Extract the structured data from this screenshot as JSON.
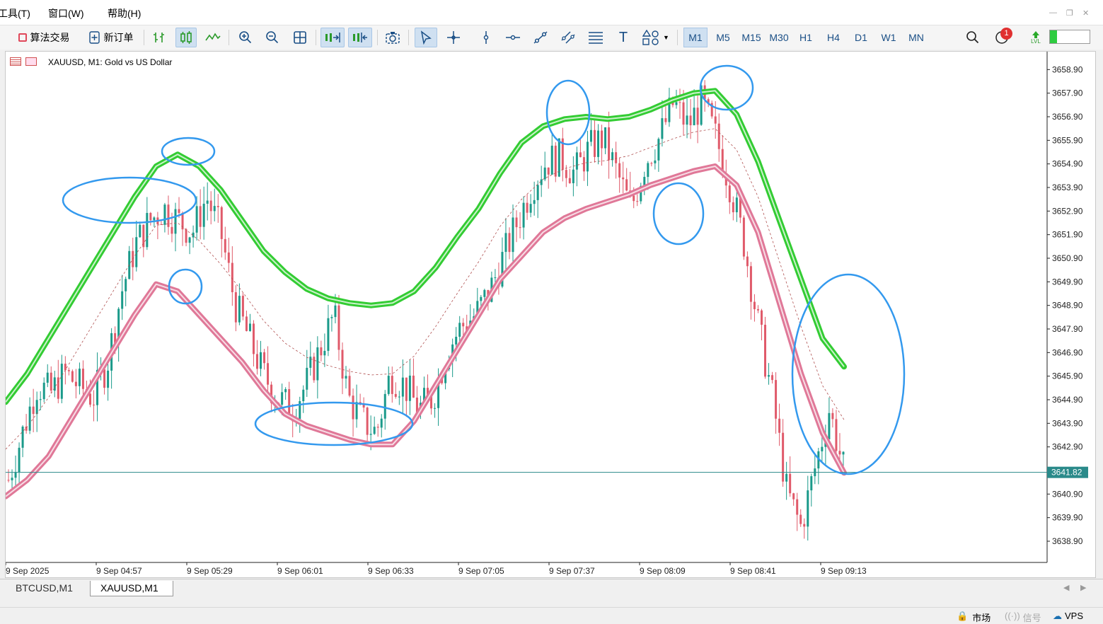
{
  "menu": {
    "tools": "工具(T)",
    "window": "窗口(W)",
    "help": "帮助(H)"
  },
  "toolbar": {
    "algo_trading": "算法交易",
    "new_order": "新订单",
    "timeframes": [
      "M1",
      "M5",
      "M15",
      "M30",
      "H1",
      "H4",
      "D1",
      "W1",
      "MN"
    ],
    "active_timeframe": "M1",
    "notification_count": "1",
    "lvl_label": "LVL"
  },
  "chart": {
    "title": "XAUUSD, M1:  Gold vs US Dollar",
    "current_price": "3641.82",
    "colors": {
      "upper_band": "#33cc33",
      "lower_band": "#e07898",
      "candle_up": "#1a9a8a",
      "candle_down": "#e05a6a",
      "circle": "#3399ee",
      "price_line": "#2a8a8a"
    }
  },
  "chart_data": {
    "type": "candlestick",
    "symbol": "XAUUSD",
    "timeframe": "M1",
    "y_axis": [
      "3658.90",
      "3657.90",
      "3656.90",
      "3655.90",
      "3654.90",
      "3653.90",
      "3652.90",
      "3651.90",
      "3650.90",
      "3649.90",
      "3648.90",
      "3647.90",
      "3646.90",
      "3645.90",
      "3644.90",
      "3643.90",
      "3642.90",
      "3641.90",
      "3640.90",
      "3639.90",
      "3638.90"
    ],
    "ylim": [
      3638.0,
      3659.3
    ],
    "x_axis": [
      "9 Sep 2025",
      "9 Sep 04:57",
      "9 Sep 05:29",
      "9 Sep 06:01",
      "9 Sep 06:33",
      "9 Sep 07:05",
      "9 Sep 07:37",
      "9 Sep 08:09",
      "9 Sep 08:41",
      "9 Sep 09:13"
    ],
    "close_path": [
      3641.5,
      3643.5,
      3645.5,
      3645.2,
      3646.0,
      3645.5,
      3645.0,
      3646.5,
      3649.5,
      3651.5,
      3652.5,
      3653.0,
      3652.5,
      3652.0,
      3653.5,
      3652.0,
      3649.0,
      3647.5,
      3646.0,
      3645.0,
      3644.5,
      3645.5,
      3647.0,
      3648.5,
      3645.0,
      3644.0,
      3643.5,
      3646.0,
      3645.5,
      3644.5,
      3645.0,
      3647.0,
      3648.0,
      3648.5,
      3649.5,
      3651.0,
      3652.5,
      3654.0,
      3655.0,
      3655.2,
      3654.5,
      3655.5,
      3656.0,
      3654.5,
      3653.0,
      3655.0,
      3656.0,
      3657.5,
      3656.5,
      3657.5,
      3656.0,
      3654.0,
      3651.5,
      3648.0,
      3645.0,
      3641.0,
      3639.5,
      3642.0,
      3644.5,
      3642.0
    ],
    "upper_band": [
      3644.8,
      3646.0,
      3647.5,
      3649.0,
      3650.5,
      3652.0,
      3653.5,
      3654.8,
      3655.3,
      3654.8,
      3653.8,
      3652.5,
      3651.2,
      3650.3,
      3649.6,
      3649.2,
      3649.0,
      3648.9,
      3649.0,
      3649.5,
      3650.5,
      3651.8,
      3653.0,
      3654.5,
      3655.8,
      3656.5,
      3656.8,
      3656.9,
      3656.8,
      3656.9,
      3657.2,
      3657.6,
      3657.9,
      3658.0,
      3657.0,
      3655.0,
      3652.5,
      3650.0,
      3647.5,
      3646.3
    ],
    "lower_band": [
      3640.8,
      3641.5,
      3642.5,
      3644.0,
      3645.5,
      3647.0,
      3648.5,
      3649.8,
      3649.5,
      3648.5,
      3647.5,
      3646.5,
      3645.3,
      3644.3,
      3643.8,
      3643.5,
      3643.2,
      3643.0,
      3643.0,
      3644.0,
      3645.5,
      3647.0,
      3648.5,
      3650.0,
      3651.0,
      3652.0,
      3652.6,
      3653.0,
      3653.3,
      3653.6,
      3654.0,
      3654.3,
      3654.6,
      3654.8,
      3654.0,
      3652.0,
      3649.0,
      3646.0,
      3643.5,
      3641.8
    ]
  },
  "tabs": [
    "BTCUSD,M1",
    "XAUUSD,M1"
  ],
  "status": {
    "market": "市场",
    "signals": "信号",
    "vps": "VPS"
  }
}
